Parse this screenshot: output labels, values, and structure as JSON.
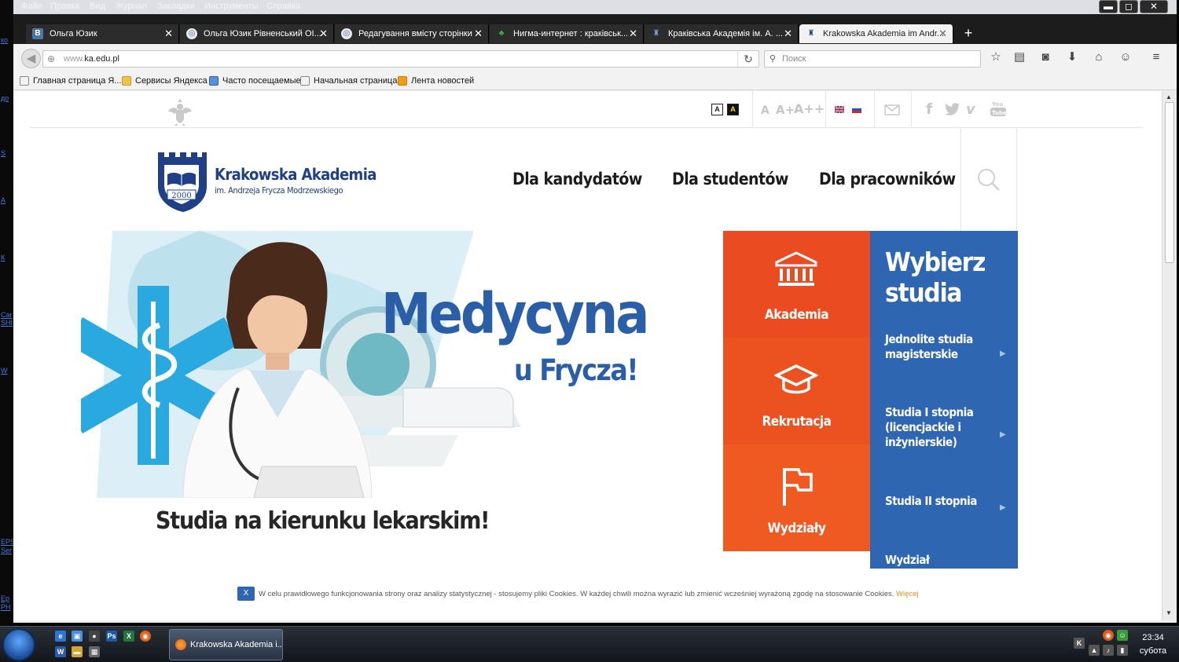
{
  "desktop_strip": [
    "ко",
    "до",
    "S",
    "А",
    "К",
    "Car",
    "SHI",
    "W",
    "EPS",
    "Ser",
    "Ep",
    "PH"
  ],
  "menubar": [
    "Файл",
    "Правка",
    "Вид",
    "Журнал",
    "Закладки",
    "Инструменты",
    "Справка"
  ],
  "window_controls": {
    "minimize": "▬",
    "maximize": "◻",
    "close": "✕"
  },
  "tabs": [
    {
      "title": "Ольга Юзик",
      "favicon": "В",
      "fav_color": "#4a76a8"
    },
    {
      "title": "Ольга Юзик Рівненський ОІ...",
      "favicon": "◎",
      "fav_color": "#e8e8e8"
    },
    {
      "title": "Редагування вмісту сторінки",
      "favicon": "◎",
      "fav_color": "#e8e8e8"
    },
    {
      "title": "Нигма-интернет : краківськ...",
      "favicon": "♣",
      "fav_color": "#2a2a2a"
    },
    {
      "title": "Краківська Академія ім. А. ...",
      "favicon": "♜",
      "fav_color": "#2a2a2a"
    },
    {
      "title": "Krakowska Akademia im Andr...",
      "favicon": "♜",
      "fav_color": "#f2f2f2"
    }
  ],
  "new_tab_label": "+",
  "address": {
    "prefix": "www.",
    "domain": "ka.edu.pl",
    "reload": "↻"
  },
  "search": {
    "placeholder": "Поиск"
  },
  "bookmarks": [
    {
      "label": "Главная страница Я...",
      "icon": "page"
    },
    {
      "label": "Сервисы Яндекса",
      "icon": "folder"
    },
    {
      "label": "Часто посещаемые",
      "icon": "app"
    },
    {
      "label": "Начальная страница",
      "icon": "page"
    },
    {
      "label": "Лента новостей",
      "icon": "rss"
    }
  ],
  "site": {
    "contrast": [
      "A",
      "A"
    ],
    "font_sizes": [
      "A",
      "A+",
      "A++"
    ],
    "logo_line1": "Krakowska Akademia",
    "logo_line2": "im. Andrzeja Frycza Modrzewskiego",
    "logo_year": "2000",
    "nav": [
      "Dla kandydatów",
      "Dla studentów",
      "Dla pracowników"
    ],
    "hero_title": "Medycyna",
    "hero_subtitle": "u Frycza!",
    "hero_caption": "Studia na kierunku lekarskim!",
    "tiles": [
      {
        "label": "Akademia",
        "color": "#ea4b20",
        "icon": "institution-icon"
      },
      {
        "label": "Rekrutacja",
        "color": "#ec5220",
        "icon": "graduation-cap-icon"
      },
      {
        "label": "Wydziały",
        "color": "#ee5a22",
        "icon": "flag-icon"
      }
    ],
    "studia_heading": "Wybierz studia",
    "studia_items": [
      "Jednolite studia magisterskie",
      "Studia I stopnia (licencjackie i inżynierskie)",
      "Studia II stopnia",
      "Wydział"
    ],
    "cookie": {
      "close": "X",
      "message": "W celu prawidłowego funkcjonowania strony oraz analizy statystycznej - stosujemy pliki Cookies. W każdej chwili można wyrazić lub zmienić wcześniej wyrażoną zgodę na stosowanie Cookies.",
      "more": "Więcej"
    }
  },
  "taskbar": {
    "active_window": "Krakowska Akademia i...",
    "time": "23:34",
    "day": "субота"
  }
}
